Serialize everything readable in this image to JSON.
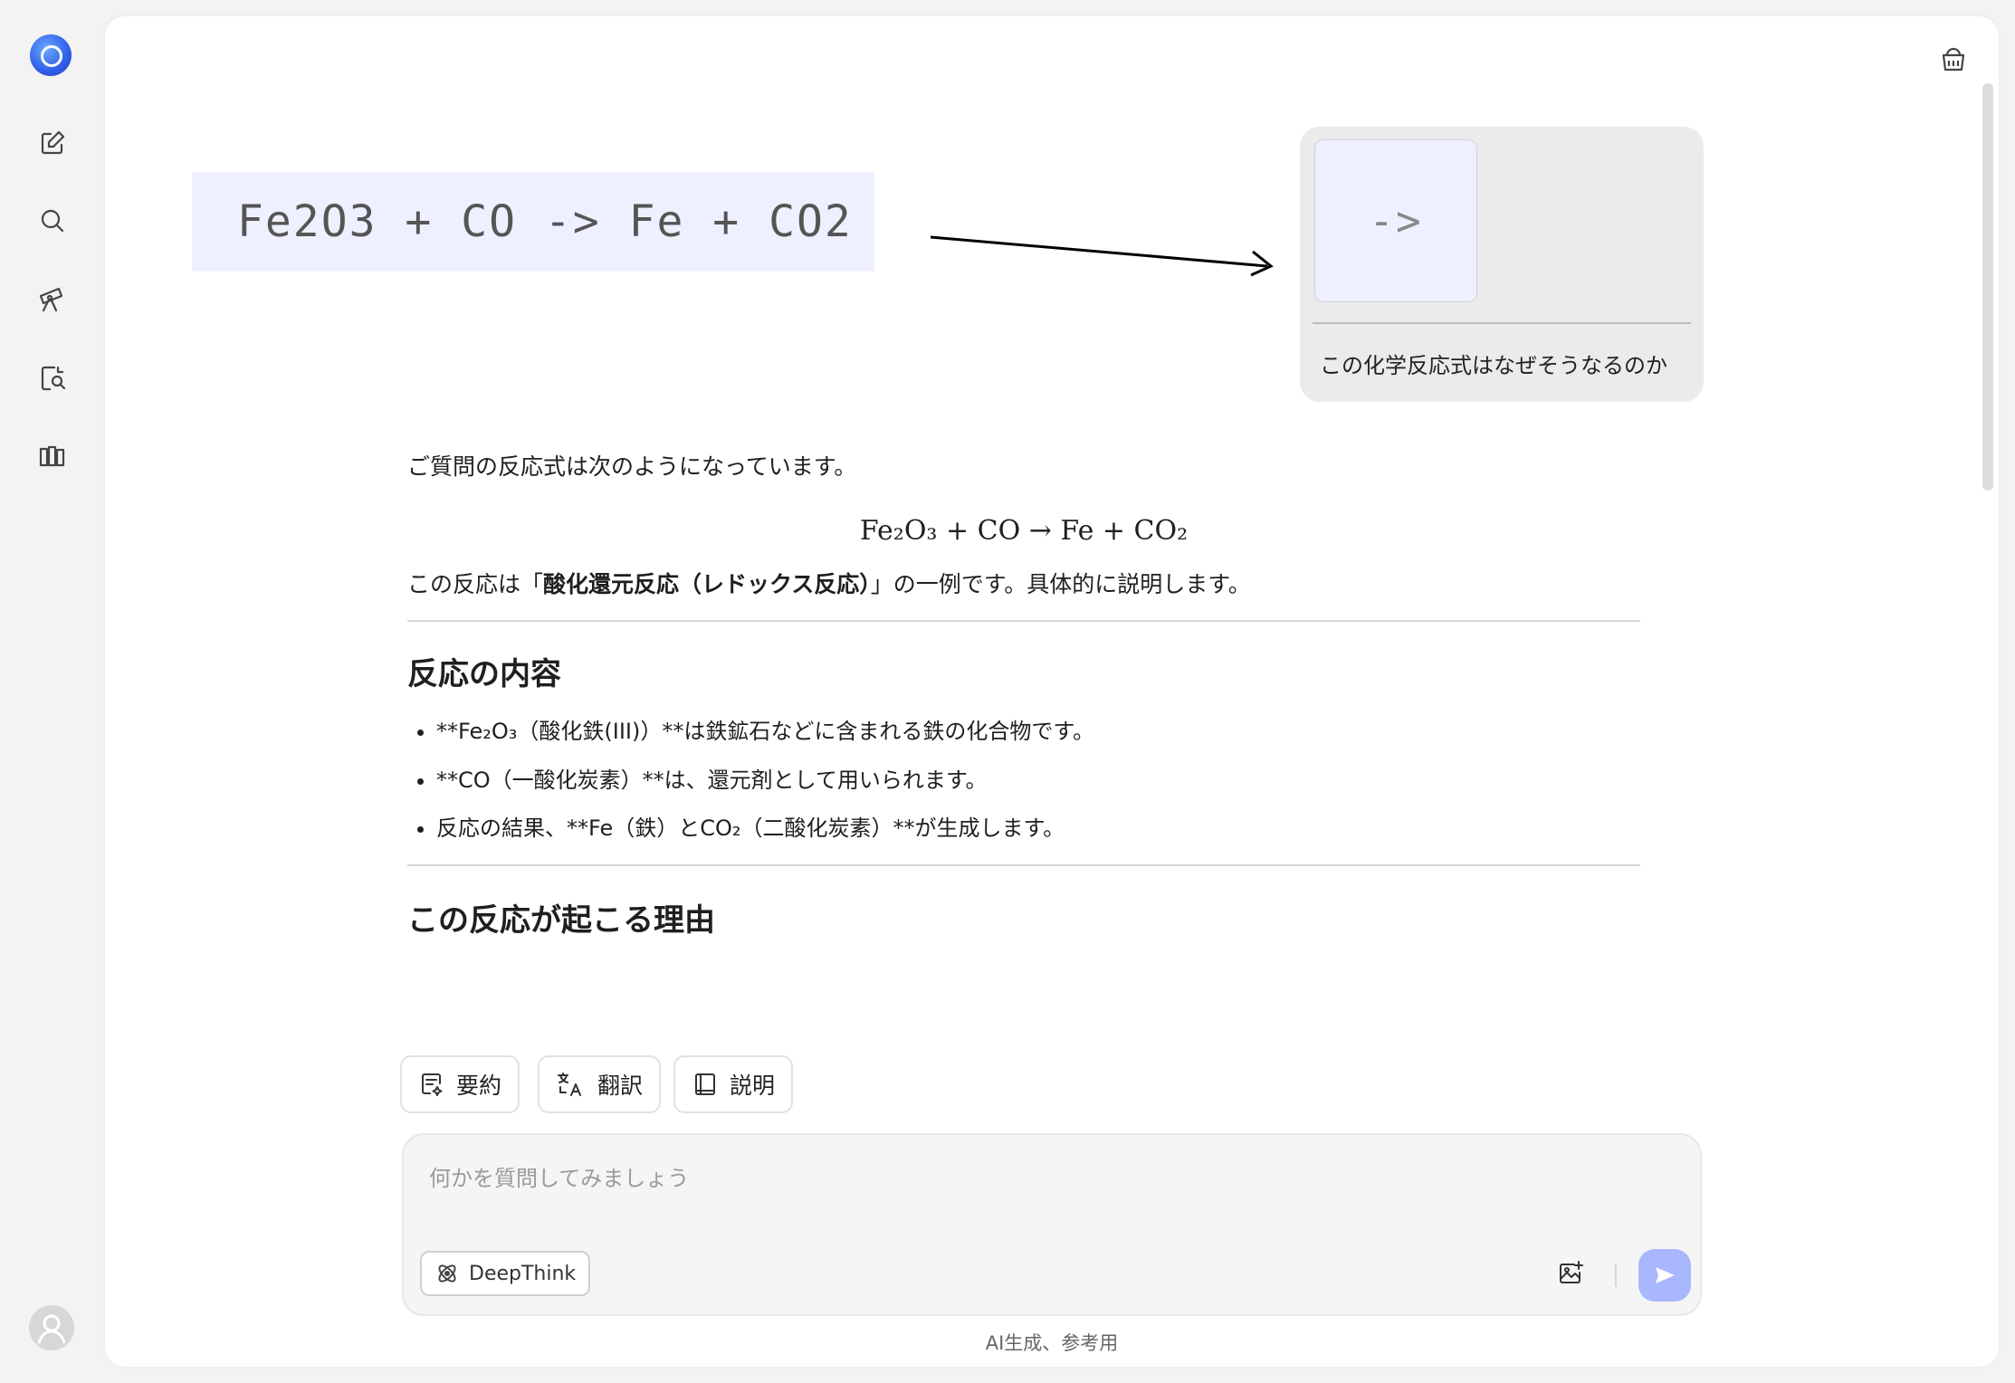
{
  "sidebar": {
    "logo": "deepseek-logo",
    "items": [
      {
        "icon": "new-chat-icon"
      },
      {
        "icon": "search-icon"
      },
      {
        "icon": "explore-icon"
      },
      {
        "icon": "document-search-icon"
      },
      {
        "icon": "library-icon"
      }
    ],
    "avatar": "user-avatar"
  },
  "header": {
    "right_icon": "bucket-icon"
  },
  "formula_image": {
    "text": "Fe2O3 + CO -> Fe + CO2"
  },
  "user_message": {
    "thumbnail_text": "->",
    "text": "この化学反応式はなぜそうなるのか"
  },
  "answer": {
    "intro": "ご質問の反応式は次のようになっています。",
    "equation": "Fe₂O₃ + CO → Fe + CO₂",
    "redox_pre": "この反応は「",
    "redox_bold": "酸化還元反応（レドックス反応）",
    "redox_post": "」の一例です。具体的に説明します。",
    "section1_title": "反応の内容",
    "section1_items": [
      "**Fe₂O₃（酸化鉄(III)）**は鉄鉱石などに含まれる鉄の化合物です。",
      "**CO（一酸化炭素）**は、還元剤として用いられます。",
      "反応の結果、**Fe（鉄）とCO₂（二酸化炭素）**が生成します。"
    ],
    "section2_title": "この反応が起こる理由"
  },
  "quick_actions": [
    {
      "label": "要約",
      "icon": "summary-icon"
    },
    {
      "label": "翻訳",
      "icon": "translate-icon"
    },
    {
      "label": "説明",
      "icon": "book-icon"
    }
  ],
  "input": {
    "placeholder": "何かを質問してみましょう",
    "value": "",
    "deepthink_label": "DeepThink"
  },
  "footer": {
    "text": "AI生成、参考用"
  },
  "colors": {
    "accent": "#a9b7ff",
    "bubble": "#ebebeb",
    "formula_bg": "#eef0ff"
  }
}
